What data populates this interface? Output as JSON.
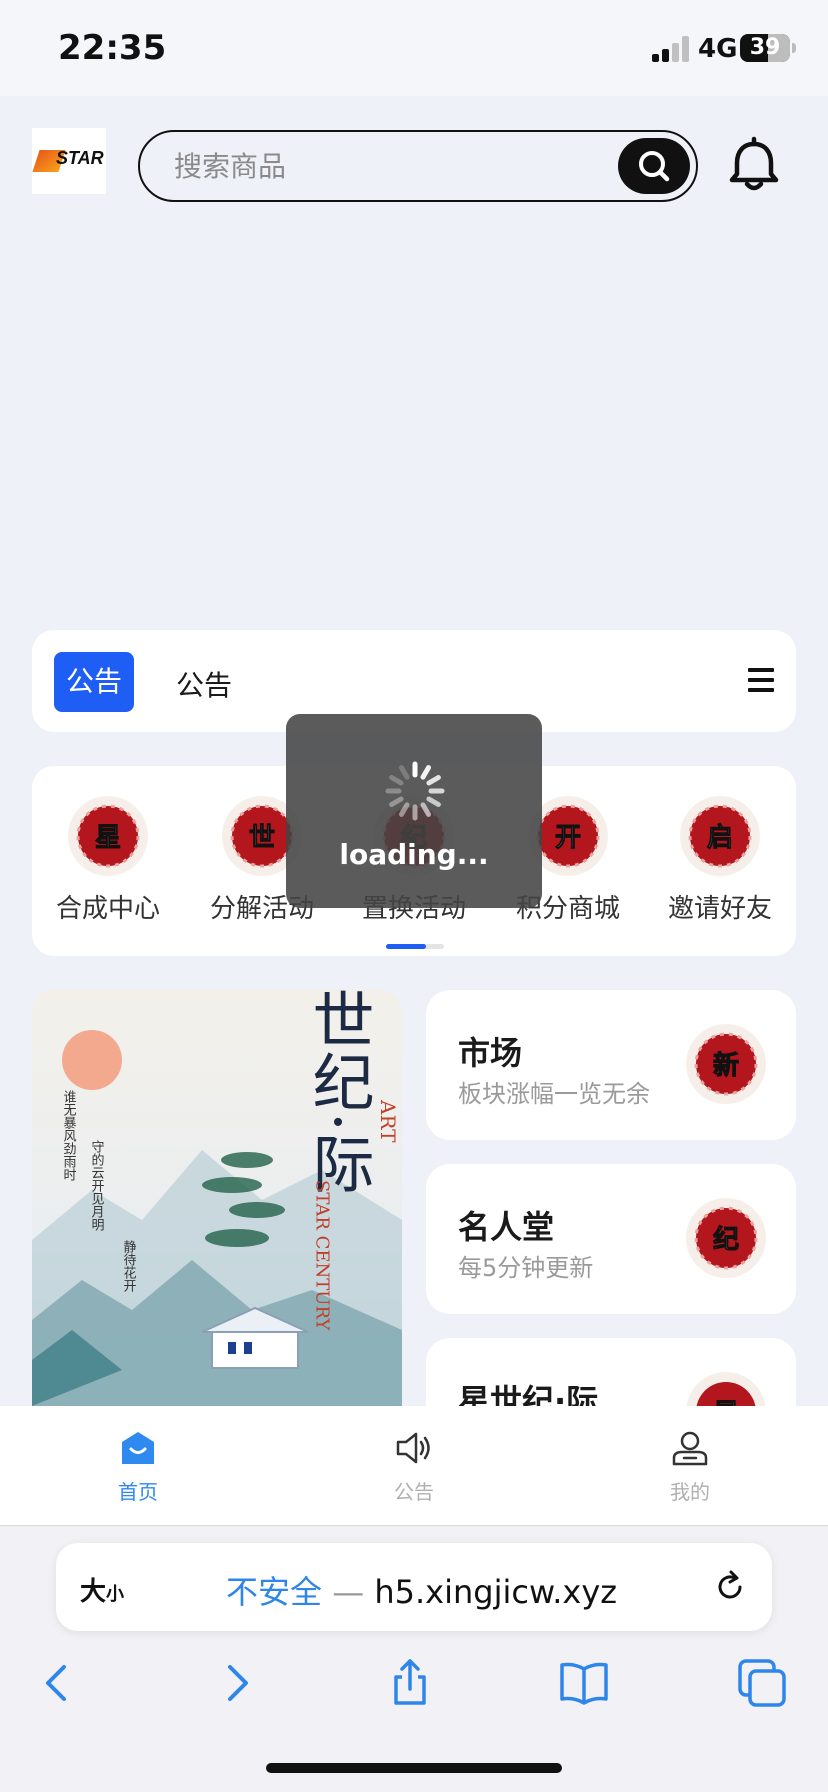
{
  "status_bar": {
    "time": "22:35",
    "network": "4G",
    "battery": "39"
  },
  "header": {
    "logo_text": "STAR",
    "search_placeholder": "搜索商品"
  },
  "notice": {
    "tag": "公告",
    "text": "公告"
  },
  "categories": [
    {
      "badge": "星",
      "label": "合成中心"
    },
    {
      "badge": "世",
      "label": "分解活动"
    },
    {
      "badge": "纪",
      "label": "置换活动"
    },
    {
      "badge": "开",
      "label": "积分商城"
    },
    {
      "badge": "启",
      "label": "邀请好友"
    }
  ],
  "poster": {
    "title": "星世纪·际",
    "art_text": "ART",
    "subtitle_en": "STAR CENTURY",
    "poem": [
      "谁无暴风劲雨时",
      "守的云开见月明",
      "静待花开"
    ]
  },
  "tiles": [
    {
      "title": "市场",
      "subtitle": "板块涨幅一览无余",
      "badge": "新"
    },
    {
      "title": "名人堂",
      "subtitle": "每5分钟更新",
      "badge": "纪"
    },
    {
      "title": "星世纪·际",
      "subtitle": "",
      "badge": "星"
    }
  ],
  "tabbar": [
    {
      "label": "首页",
      "active": true
    },
    {
      "label": "公告",
      "active": false
    },
    {
      "label": "我的",
      "active": false
    }
  ],
  "browser": {
    "text_size": "大",
    "text_size_small": "小",
    "insecure_label": "不安全",
    "separator": "—",
    "domain": "h5.xingjicw.xyz"
  },
  "loading": {
    "text": "loading..."
  },
  "colors": {
    "accent": "#1e5ef5",
    "tab_active": "#2f8af0",
    "badge_red": "#b3161c"
  }
}
